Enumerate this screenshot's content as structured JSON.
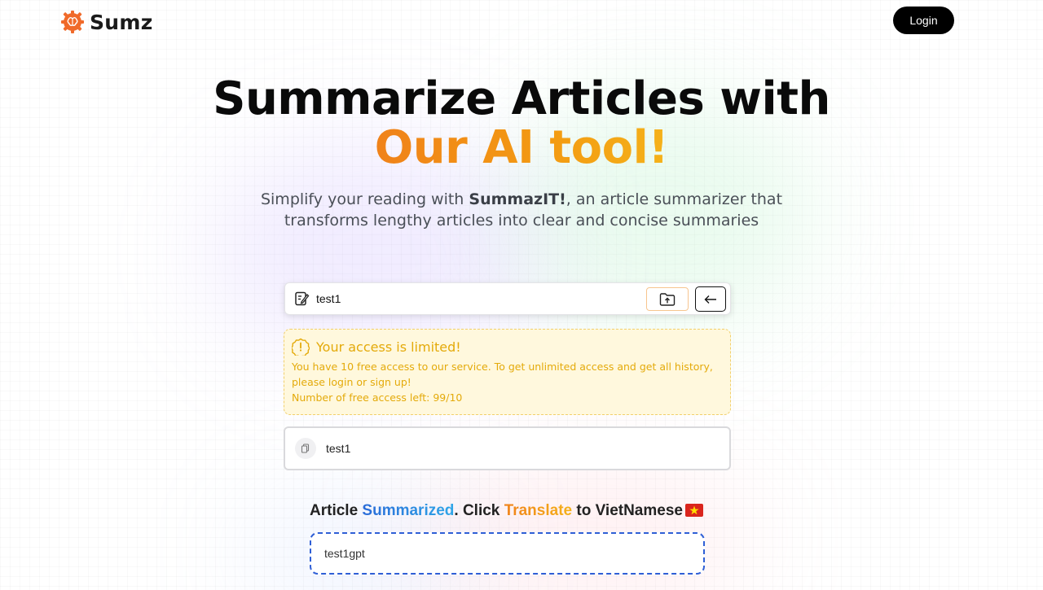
{
  "header": {
    "brand": "Sumz",
    "login_label": "Login"
  },
  "hero": {
    "title_line1": "Summarize Articles with",
    "title_line2": "Our AI tool!",
    "subtitle_prefix": "Simplify your reading with ",
    "subtitle_brand": "SummazIT!",
    "subtitle_suffix": ", an article summarizer that transforms lengthy articles into clear and concise summaries"
  },
  "url_form": {
    "value": "test1",
    "icons": {
      "input": "link-icon",
      "upload": "folder-upload-icon",
      "submit": "arrow-left-icon"
    }
  },
  "warning": {
    "title": "Your access is limited!",
    "line1": "You have 10 free access to our service. To get unlimited access and get all history, please login or sign up!",
    "line2": "Number of free access left: 99/10",
    "icon": "alert-icon"
  },
  "history": {
    "items": [
      {
        "text": "test1",
        "icon": "copy-icon"
      }
    ]
  },
  "result": {
    "heading_a": "Article ",
    "heading_b": "Summarized",
    "heading_c": ". Click ",
    "heading_d": "Translate",
    "heading_e": " to VietNamese",
    "flag": "vietnam-flag-icon",
    "summary": "test1gpt"
  },
  "colors": {
    "accent_orange": "#f0821a",
    "accent_blue": "#2a6bd8",
    "warning_text": "#e4aa0a",
    "warning_bg": "#fff8dd"
  }
}
